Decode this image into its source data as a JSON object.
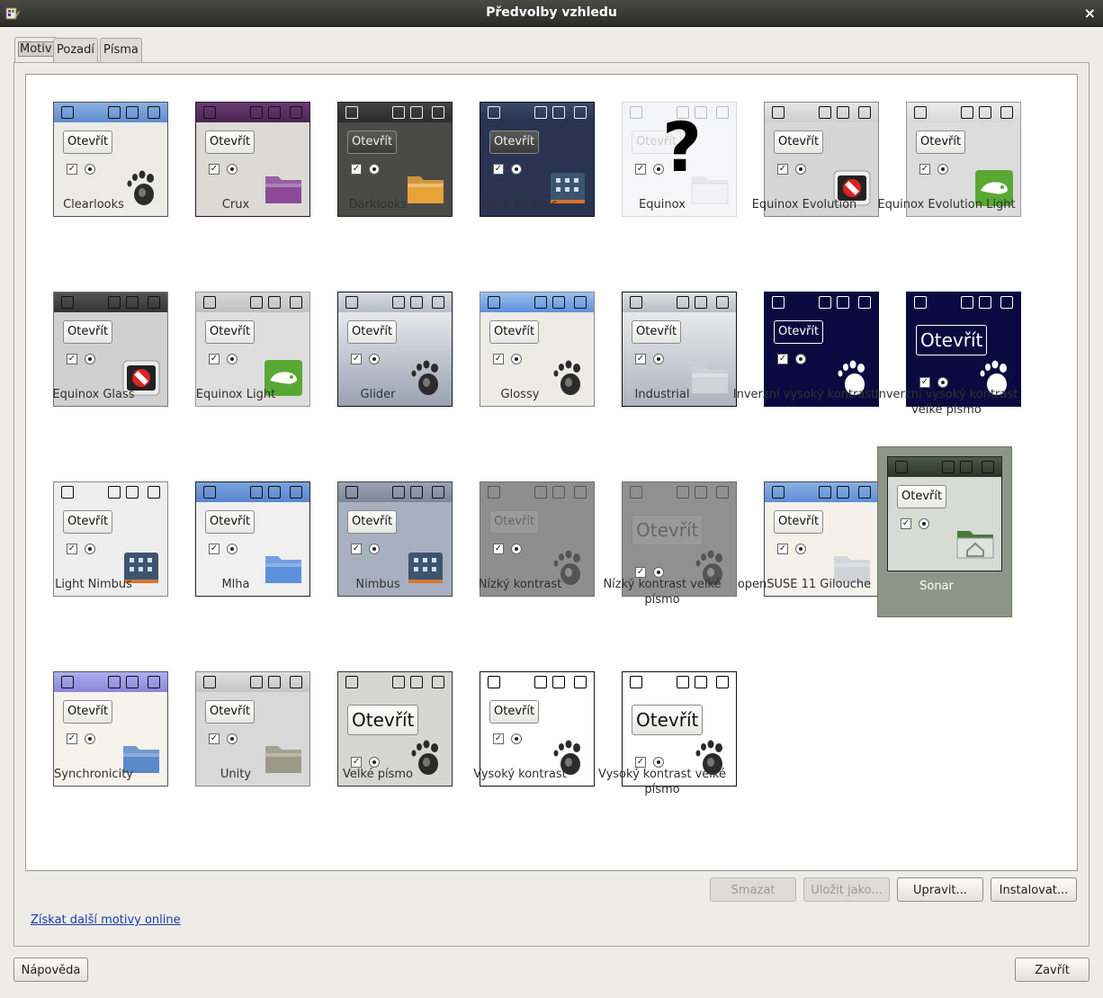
{
  "window": {
    "title": "Předvolby vzhledu",
    "close_glyph": "×"
  },
  "tabs": [
    {
      "label": "Motiv",
      "active": true
    },
    {
      "label": "Pozadí",
      "active": false
    },
    {
      "label": "Písma",
      "active": false
    }
  ],
  "themes": [
    {
      "name": "Clearlooks",
      "style": "clearlooks",
      "icon": "gnome-foot-icon",
      "selected": false
    },
    {
      "name": "Crux",
      "style": "crux",
      "icon": "folder-icon",
      "selected": false
    },
    {
      "name": "Darklooks",
      "style": "darklooks",
      "icon": "folder-icon",
      "selected": false
    },
    {
      "name": "Dark Nimbus",
      "style": "darknimbus",
      "icon": "building-icon",
      "selected": false
    },
    {
      "name": "Equinox",
      "style": "equinox",
      "icon": "question-mark-icon",
      "selected": false
    },
    {
      "name": "Equinox Evolution",
      "style": "equinoxevo",
      "icon": "no-entry-icon",
      "selected": false
    },
    {
      "name": "Equinox Evolution Light",
      "style": "equinoxevolight",
      "icon": "chameleon-icon",
      "selected": false
    },
    {
      "name": "Equinox Glass",
      "style": "equinoxglass",
      "icon": "no-entry-icon",
      "selected": false
    },
    {
      "name": "Equinox Light",
      "style": "equinoxlight",
      "icon": "chameleon-icon",
      "selected": false
    },
    {
      "name": "Glider",
      "style": "glider",
      "icon": "gnome-foot-icon",
      "selected": false
    },
    {
      "name": "Glossy",
      "style": "glossy",
      "icon": "gnome-foot-icon",
      "selected": false
    },
    {
      "name": "Industrial",
      "style": "industrial",
      "icon": "folder-icon",
      "selected": false
    },
    {
      "name": "Inverzní vysoký kontrast",
      "style": "inverse",
      "icon": "gnome-foot-icon",
      "selected": false
    },
    {
      "name": "Inverzní vysoký kontrast velké písmo",
      "style": "inverselarge",
      "icon": "gnome-foot-icon",
      "selected": false
    },
    {
      "name": "Light Nimbus",
      "style": "lightnimbus",
      "icon": "building-icon",
      "selected": false
    },
    {
      "name": "Mlha",
      "style": "mlha",
      "icon": "folder-icon",
      "selected": false
    },
    {
      "name": "Nimbus",
      "style": "nimbus",
      "icon": "building-icon",
      "selected": false
    },
    {
      "name": "Nízký kontrast",
      "style": "lowcontrast",
      "icon": "gnome-foot-icon",
      "selected": false
    },
    {
      "name": "Nízký kontrast velké písmo",
      "style": "lowcontrastlarge",
      "icon": "gnome-foot-icon",
      "selected": false
    },
    {
      "name": "openSUSE 11 Gilouche",
      "style": "gilouche",
      "icon": "folder-icon",
      "selected": false
    },
    {
      "name": "Sonar",
      "style": "sonar",
      "icon": "home-folder-icon",
      "selected": true
    },
    {
      "name": "Synchronicity",
      "style": "synchronicity",
      "icon": "folder-icon",
      "selected": false
    },
    {
      "name": "Unity",
      "style": "unity",
      "icon": "folder-icon",
      "selected": false
    },
    {
      "name": "Velké písmo",
      "style": "largeprint",
      "icon": "gnome-foot-icon",
      "selected": false
    },
    {
      "name": "Vysoký kontrast",
      "style": "highcontrast",
      "icon": "gnome-foot-icon",
      "selected": false
    },
    {
      "name": "Vysoký kontrast velké písmo",
      "style": "highcontrastlarge",
      "icon": "gnome-foot-icon",
      "selected": false
    }
  ],
  "preview": {
    "button_label": "Otevřít",
    "check_mark": "✓",
    "question_mark": "?"
  },
  "actions": {
    "delete": {
      "label": "Smazat",
      "enabled": false
    },
    "save_as": {
      "label": "Uložit jako...",
      "enabled": false
    },
    "customize": {
      "label": "Upravit...",
      "enabled": true
    },
    "install": {
      "label": "Instalovat...",
      "enabled": true
    }
  },
  "online_link": "Získat další motivy online",
  "footer": {
    "help_label": "Nápověda",
    "close_label": "Zavřít"
  },
  "colors": {
    "selection": "#8e9689",
    "link": "#1a3aa8",
    "titlebar": "#2c2c28"
  }
}
